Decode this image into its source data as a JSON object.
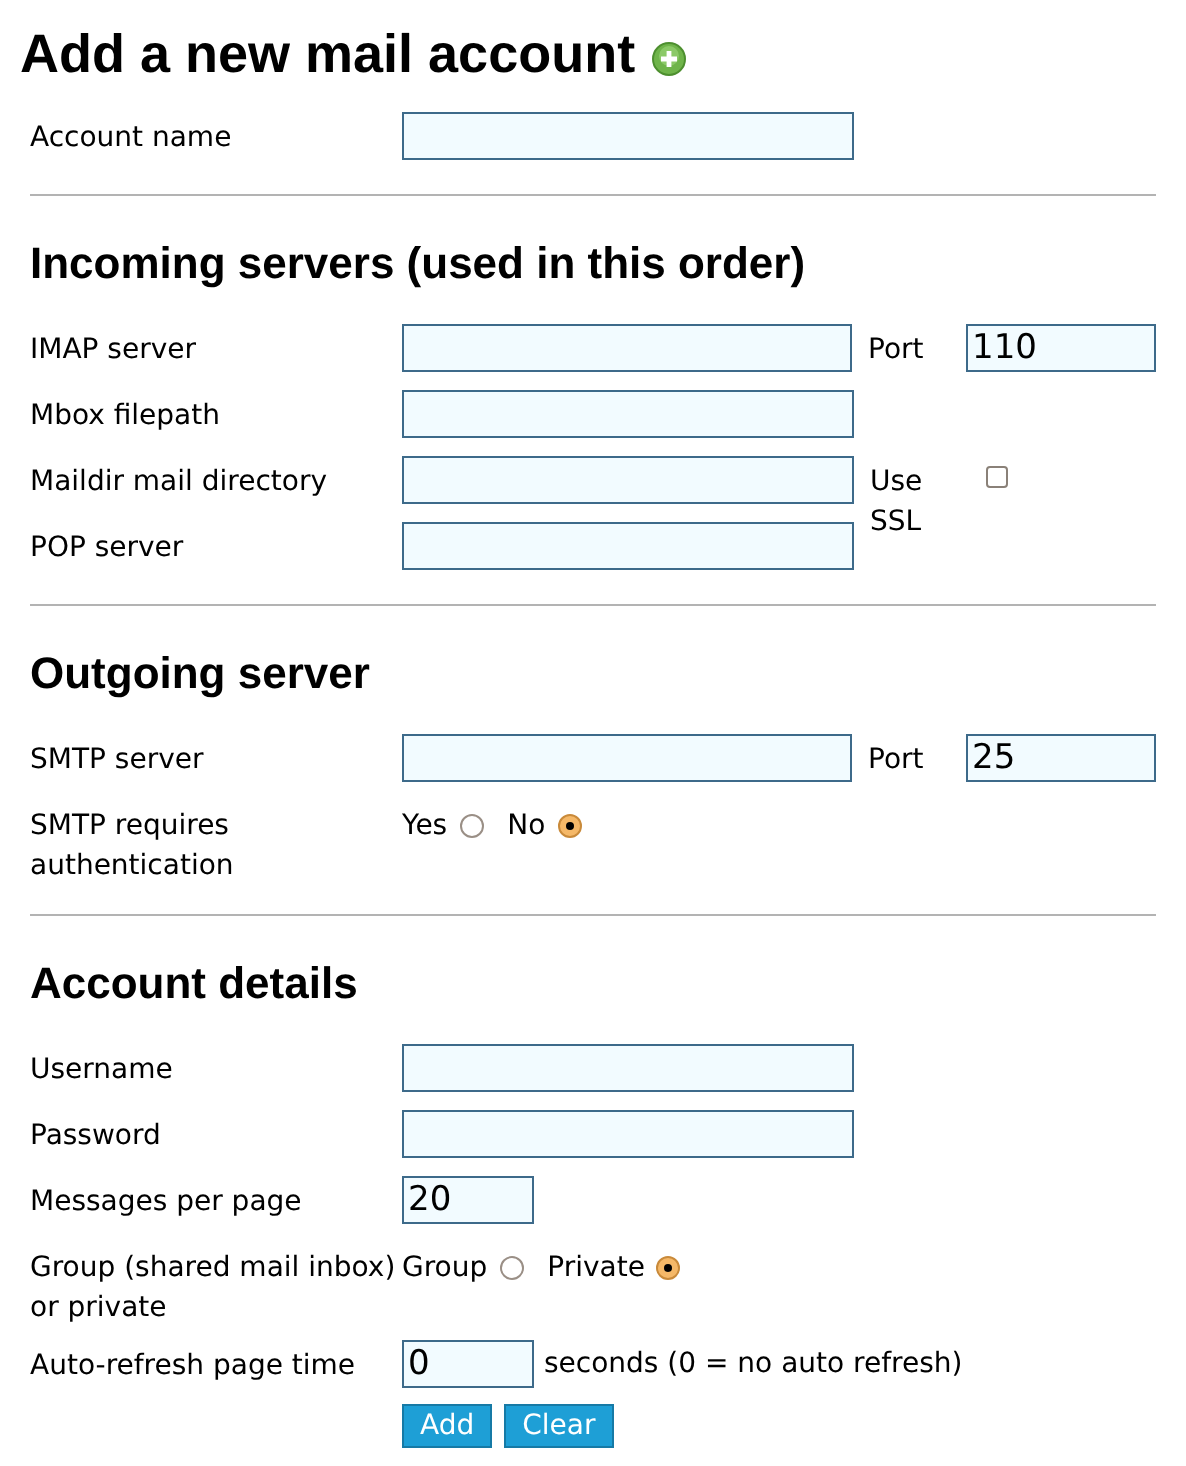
{
  "title": "Add a new mail account",
  "account": {
    "label": "Account name"
  },
  "sections": [
    {
      "heading": "Incoming servers (used in this order)",
      "rows": [
        {
          "kind": "text",
          "label": "IMAP server",
          "side": {
            "kind": "port",
            "label": "Port",
            "value": "110"
          }
        },
        {
          "kind": "text",
          "label": "Mbox filepath"
        },
        {
          "kind": "text",
          "label": "Maildir mail directory",
          "side": {
            "kind": "checkbox",
            "label": "Use SSL",
            "checked": false
          }
        },
        {
          "kind": "text",
          "label": "POP server"
        }
      ]
    },
    {
      "heading": "Outgoing server",
      "rows": [
        {
          "kind": "text",
          "label": "SMTP server",
          "side": {
            "kind": "port",
            "label": "Port",
            "value": "25"
          }
        },
        {
          "kind": "radio",
          "label": "SMTP requires authentication",
          "options": [
            {
              "label": "Yes",
              "selected": false
            },
            {
              "label": "No",
              "selected": true
            }
          ]
        }
      ]
    },
    {
      "heading": "Account details",
      "rows": [
        {
          "kind": "text",
          "label": "Username"
        },
        {
          "kind": "text",
          "label": "Password"
        },
        {
          "kind": "short",
          "label": "Messages per page",
          "value": "20"
        },
        {
          "kind": "radio",
          "label": "Group (shared mail inbox) or private",
          "options": [
            {
              "label": "Group",
              "selected": false
            },
            {
              "label": "Private",
              "selected": true
            }
          ]
        },
        {
          "kind": "short",
          "label": "Auto-refresh page time",
          "value": "0",
          "suffix": "seconds (0 = no auto refresh)"
        }
      ]
    }
  ],
  "buttons": [
    "Add",
    "Clear"
  ]
}
